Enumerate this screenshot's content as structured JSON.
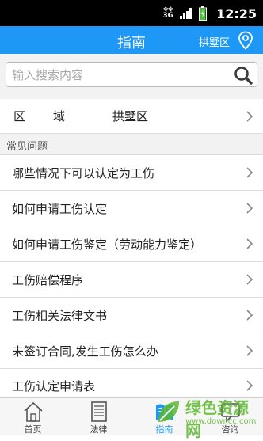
{
  "status_bar": {
    "network": "3G",
    "network_small": "令令",
    "time": "12:25"
  },
  "header": {
    "title": "指南",
    "region": "拱墅区"
  },
  "search": {
    "placeholder": "输入搜索内容"
  },
  "region_row": {
    "label_1": "区",
    "label_2": "域",
    "value": "拱墅区"
  },
  "section": {
    "title": "常见问题"
  },
  "faq_items": [
    {
      "label": "哪些情况下可以认定为工伤"
    },
    {
      "label": "如何申请工伤认定"
    },
    {
      "label": "如何申请工伤鉴定（劳动能力鉴定）"
    },
    {
      "label": "工伤赔偿程序"
    },
    {
      "label": "工伤相关法律文书"
    },
    {
      "label": "未签订合同,发生工伤怎么办"
    },
    {
      "label": "工伤认定申请表"
    }
  ],
  "tabs": [
    {
      "label": "首页",
      "icon": "home-icon"
    },
    {
      "label": "法律",
      "icon": "document-icon"
    },
    {
      "label": "指南",
      "icon": "book-icon",
      "active": true
    },
    {
      "label": "咨询",
      "icon": "chat-icon"
    }
  ],
  "watermark": {
    "text": "绿色资源网",
    "url": "www.downcc.com"
  },
  "colors": {
    "accent": "#1e98f6",
    "status_bar": "#000000",
    "section_bg": "#f2f2f2",
    "watermark": "#5cb82e"
  }
}
